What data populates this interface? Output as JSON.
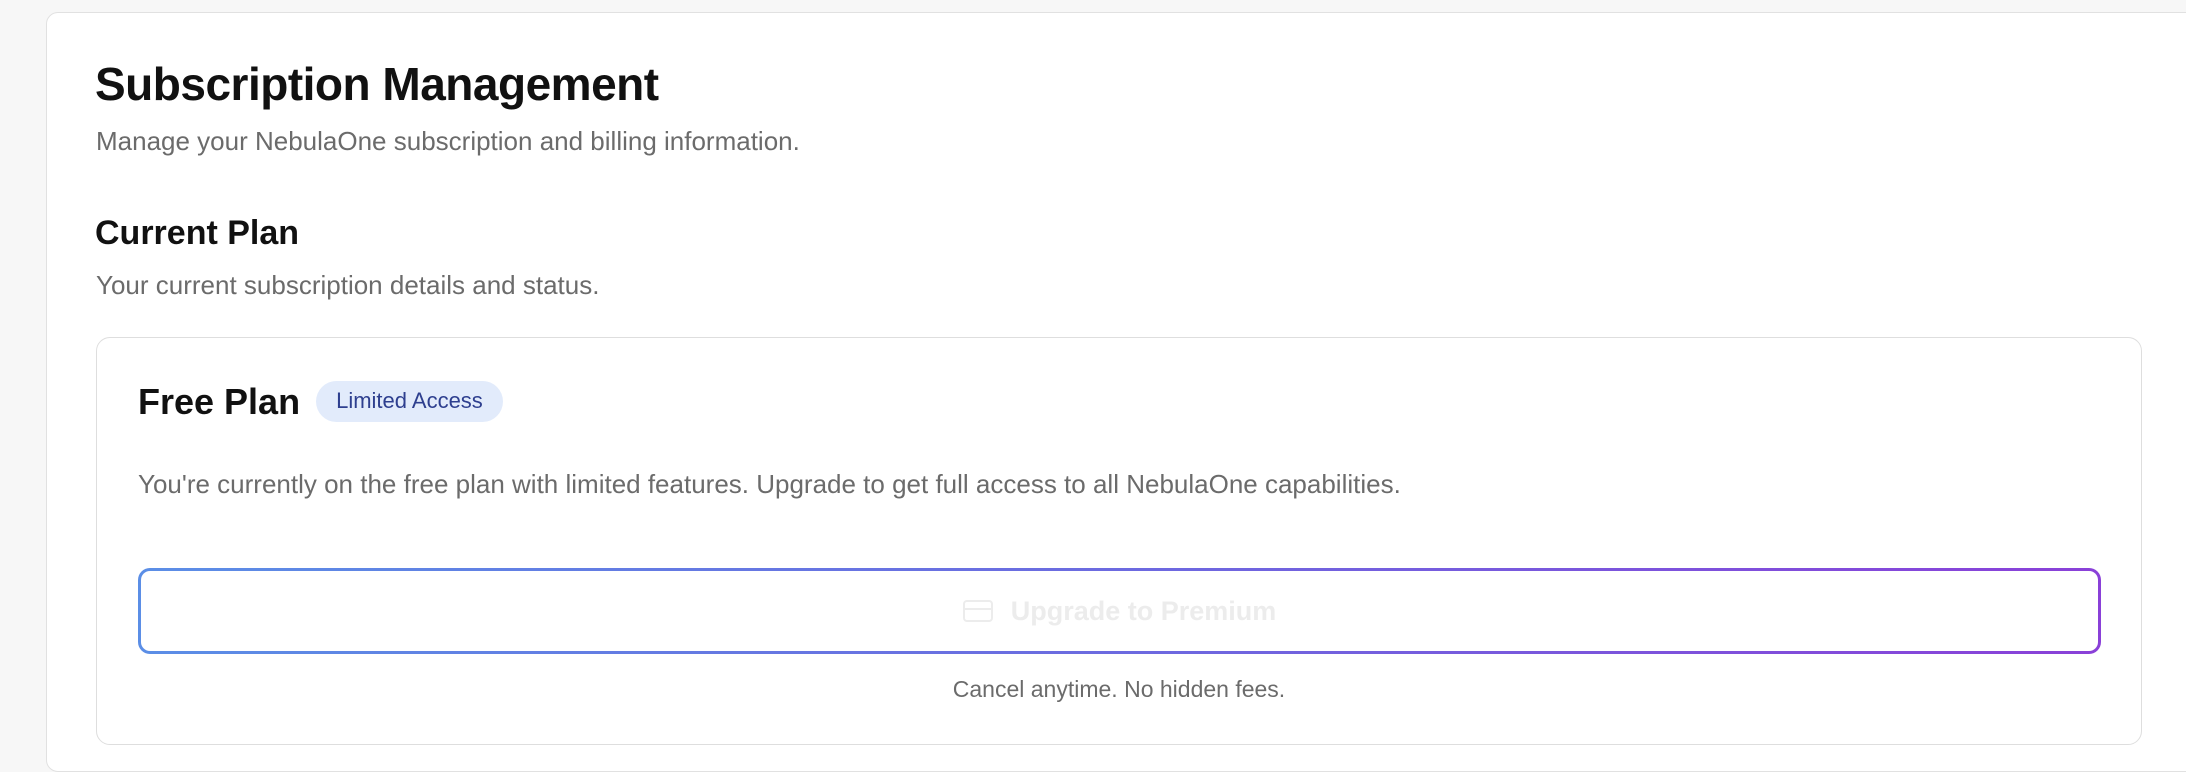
{
  "header": {
    "title": "Subscription Management",
    "subtitle": "Manage your NebulaOne subscription and billing information."
  },
  "current_plan_section": {
    "title": "Current Plan",
    "subtitle": "Your current subscription details and status."
  },
  "plan_card": {
    "name": "Free Plan",
    "badge": "Limited Access",
    "description": "You're currently on the free plan with limited features. Upgrade to get full access to all NebulaOne capabilities.",
    "upgrade_button_label": "Upgrade to Premium",
    "upgrade_button_icon": "credit-card-icon",
    "note": "Cancel anytime. No hidden fees."
  },
  "colors": {
    "badge_bg": "#e2ebfb",
    "badge_text": "#2e3f8f",
    "button_gradient_start": "#5b8ee6",
    "button_gradient_end": "#8a40d8"
  }
}
